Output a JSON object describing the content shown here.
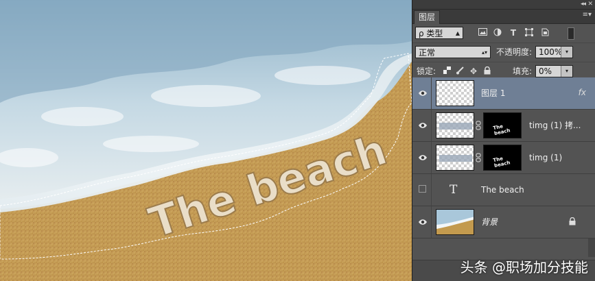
{
  "panel": {
    "tab_label": "图层",
    "filter": {
      "kind_label": "ρ 类型"
    },
    "blend_mode": "正常",
    "opacity_label": "不透明度:",
    "opacity_value": "100%",
    "lock_label": "锁定:",
    "fill_label": "填充:",
    "fill_value": "0%",
    "layers": [
      {
        "name": "图层 1",
        "selected": true,
        "visible": true,
        "fx": "fx"
      },
      {
        "name": "timg (1) 拷...",
        "selected": false,
        "visible": true
      },
      {
        "name": "timg (1)",
        "selected": false,
        "visible": true
      },
      {
        "name": "The beach",
        "selected": false,
        "visible": false,
        "type_glyph": "T"
      },
      {
        "name": "背景",
        "selected": false,
        "visible": true,
        "locked": true
      }
    ]
  },
  "canvas": {
    "sand_text": "The beach"
  },
  "watermark": "头条 @职场加分技能",
  "colors": {
    "panel_bg": "#535353",
    "selected_layer": "#6f7f95",
    "sand": "#c39a4e",
    "water": "#a9c7da"
  }
}
